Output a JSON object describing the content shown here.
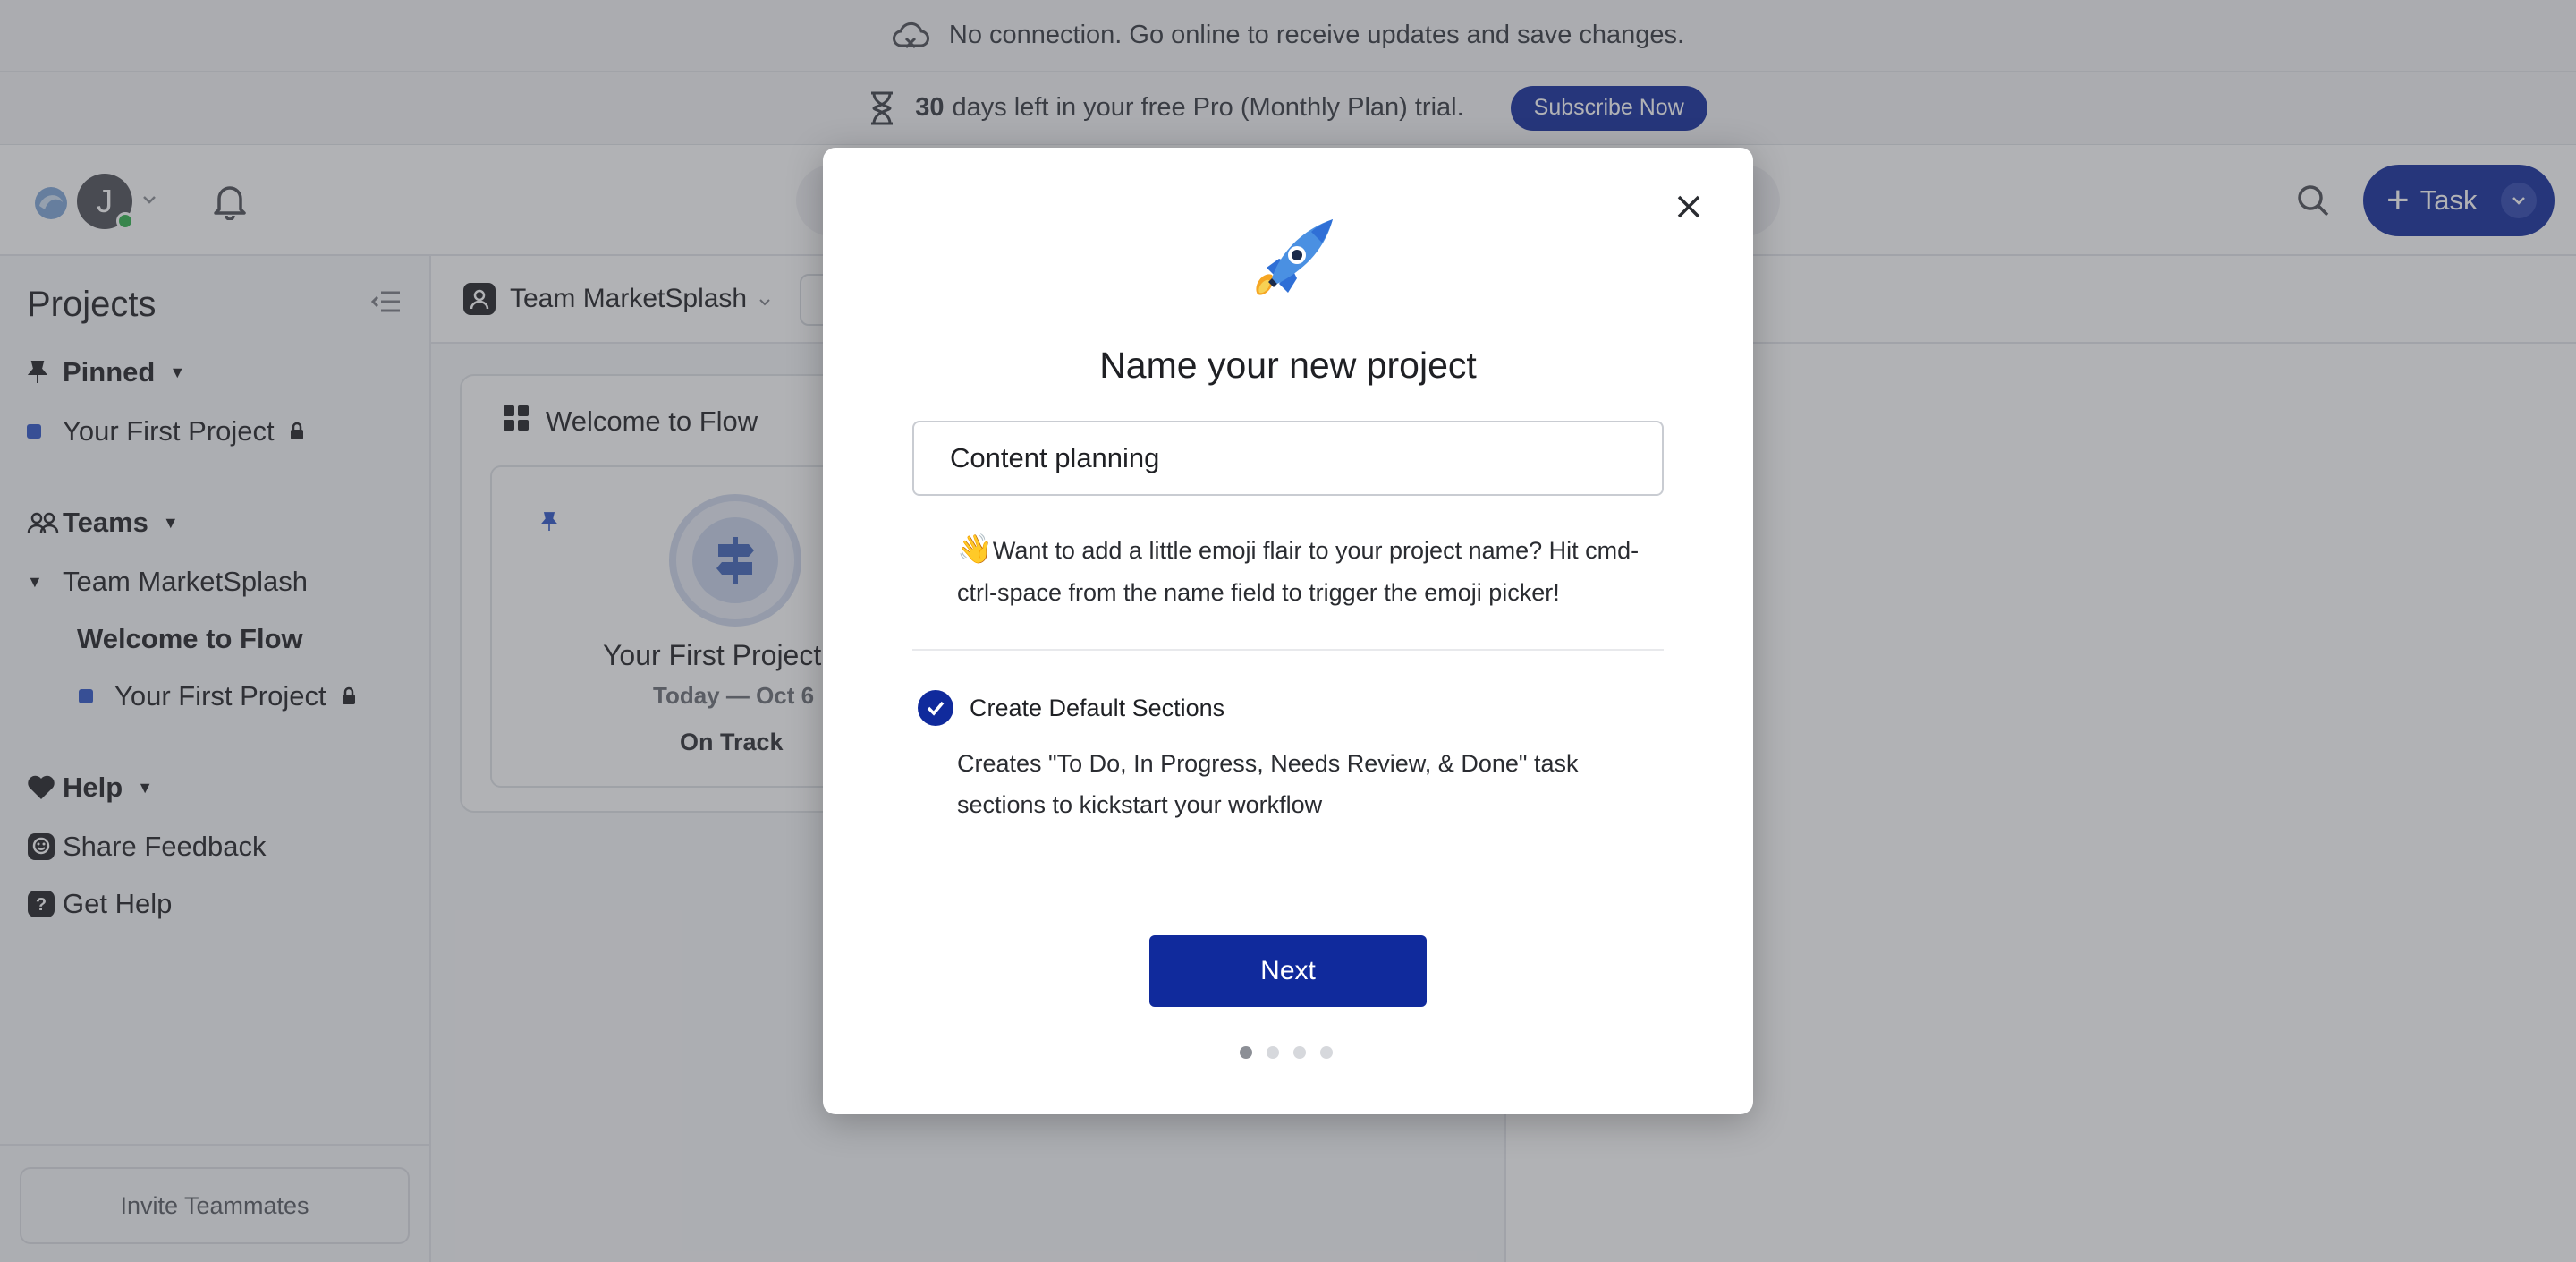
{
  "banners": {
    "offline_message": "No connection. Go online to receive updates and save changes.",
    "trial_days": "30",
    "trial_message": "days left in your free Pro (Monthly Plan) trial.",
    "subscribe_label": "Subscribe Now"
  },
  "topbar": {
    "avatar_initial": "J",
    "task_label": "Task"
  },
  "sidebar": {
    "title": "Projects",
    "pinned_label": "Pinned",
    "pinned_project": "Your First Project",
    "teams_label": "Teams",
    "team_name": "Team MarketSplash",
    "team_items": [
      "Welcome to Flow",
      "Your First Project"
    ],
    "help_label": "Help",
    "share_feedback": "Share Feedback",
    "get_help": "Get Help",
    "invite_label": "Invite Teammates"
  },
  "main": {
    "team_selector": "Team MarketSplash",
    "board_title": "Welcome to Flow",
    "card": {
      "name": "Your First Project",
      "date": "Today — Oct 6",
      "status": "On Track"
    }
  },
  "modal": {
    "title": "Name your new project",
    "input_value": "Content planning",
    "tip_emoji": "👋",
    "tip_text": "Want to add a little emoji flair to your project name? Hit cmd-ctrl-space from the name field to trigger the emoji picker!",
    "option_label": "Create Default Sections",
    "option_description": "Creates \"To Do, In Progress, Needs Review, & Done\" task sections to kickstart your workflow",
    "option_checked": true,
    "next_label": "Next",
    "pager": {
      "current": 1,
      "total": 4
    }
  },
  "colors": {
    "brand": "#102a9c",
    "project_dot": "#2d55c8",
    "presence": "#2fb24a"
  },
  "icons": [
    "cloud-offline-icon",
    "hourglass-icon",
    "logo-icon",
    "bell-icon",
    "search-icon",
    "plus-icon",
    "chevron-down-icon",
    "pin-icon",
    "lock-icon",
    "team-icon",
    "heart-icon",
    "feedback-icon",
    "question-icon",
    "grid-icon",
    "signpost-icon",
    "close-icon",
    "rocket-icon",
    "check-icon",
    "collapse-sidebar-icon"
  ]
}
